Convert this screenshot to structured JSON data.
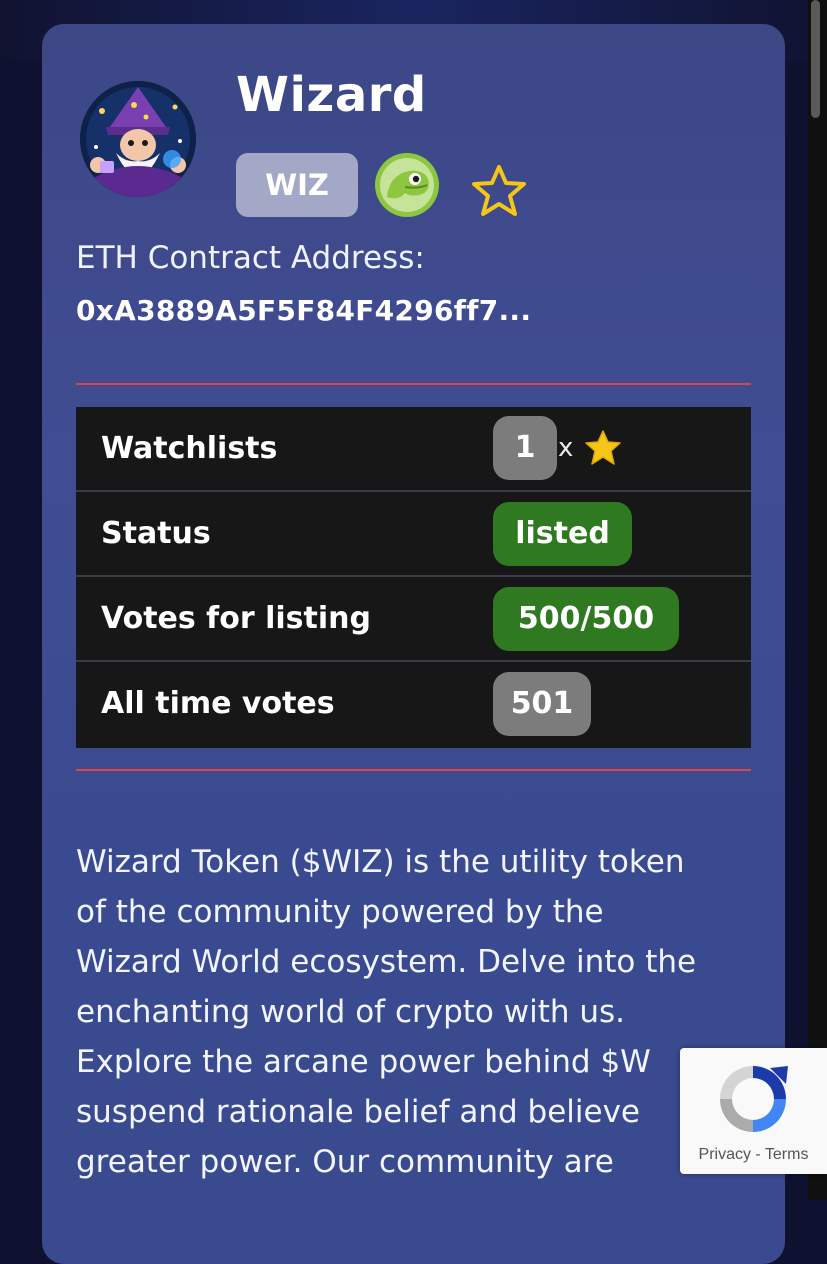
{
  "token": {
    "name": "Wizard",
    "ticker": "WIZ",
    "contract_label": "ETH Contract Address:",
    "contract_address": "0xA3889A5F5F84F4296ff7..."
  },
  "stats": {
    "watchlists": {
      "label": "Watchlists",
      "count": "1",
      "times": "x"
    },
    "status": {
      "label": "Status",
      "value": "listed"
    },
    "votes_for_listing": {
      "label": "Votes for listing",
      "value": "500/500"
    },
    "all_time_votes": {
      "label": "All time votes",
      "value": "501"
    }
  },
  "description": {
    "lines": [
      "Wizard Token ($WIZ) is the utility token",
      "of the community powered by the",
      "Wizard World ecosystem. Delve into the",
      "enchanting world of crypto with us.",
      "Explore the arcane power behind $W",
      "suspend rationale belief and believe",
      "greater power. Our community are"
    ]
  },
  "recaptcha": {
    "privacy": "Privacy",
    "separator": "-",
    "terms": "Terms"
  },
  "colors": {
    "card_bg": "#3f4a8c",
    "status_green": "#2f7a21",
    "pill_gray": "#7c7c7c",
    "divider_red": "#d9444e",
    "star_yellow": "#f5c518"
  },
  "icons": {
    "coingecko": "coingecko-icon",
    "favorite": "star-outline-icon",
    "watchlist": "star-icon",
    "recaptcha": "recaptcha-icon"
  }
}
